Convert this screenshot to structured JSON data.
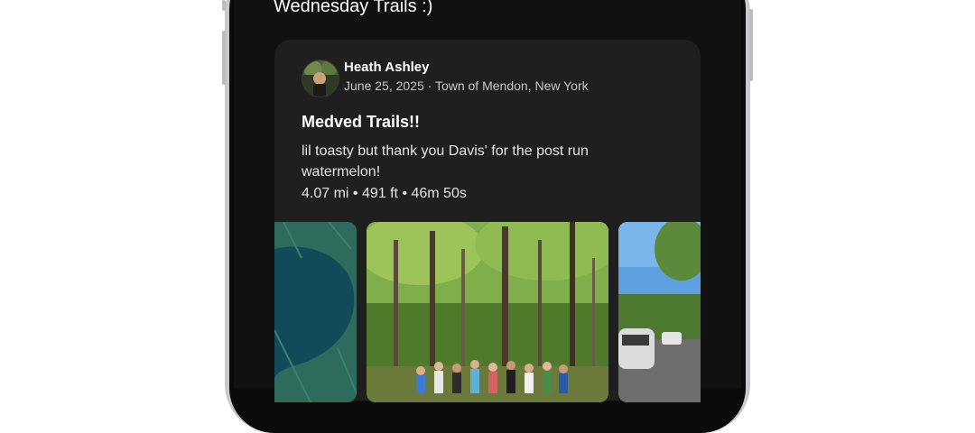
{
  "feed": {
    "header_text": "Wednesday Trails :)"
  },
  "post": {
    "author": "Heath Ashley",
    "date": "June 25, 2025",
    "location": "Town of Mendon, New York",
    "separator": "·",
    "title": "Medved Trails!!",
    "description": "lil toasty but thank you Davis' for the post run watermelon!",
    "stats": "4.07 mi • 491 ft • 46m 50s"
  },
  "media": {
    "items": [
      "map",
      "group-photo",
      "parking-lot-photo"
    ]
  },
  "colors": {
    "screen_bg": "#111111",
    "card_bg": "#1f1f1f",
    "map_bg": "#2e6b5c",
    "map_water": "#134a5a"
  }
}
